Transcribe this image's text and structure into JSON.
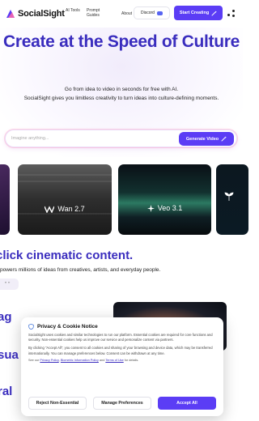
{
  "nav": {
    "brand": "SocialSight",
    "links": {
      "ai_tools": "AI Tools",
      "prompt_guides": "Prompt Guides",
      "about": "About"
    },
    "discord_label": "Discord",
    "start_label": "Start Creating"
  },
  "hero": {
    "title": "Create at the Speed of Culture",
    "subtitle_1": "Go from idea to video in seconds for free with AI.",
    "subtitle_2": "SocialSight gives you limitless creativity to turn ideas into culture-defining moments.",
    "prompt_placeholder": "Imagine anything...",
    "generate_label": "Generate Video"
  },
  "carousel": {
    "cards": [
      {
        "label": "Wan 2.7",
        "icon": "wan-logo-icon"
      },
      {
        "label": "Veo 3.1",
        "icon": "veo-star-icon"
      }
    ]
  },
  "section": {
    "title": "click cinematic content.",
    "subtitle": "powers millions of ideas from creatives, artists, and everyday people.",
    "quote_glyph": "” ”",
    "words": [
      "ag",
      "sua",
      "ral"
    ]
  },
  "cookie": {
    "title": "Privacy & Cookie Notice",
    "para1": "SocialSight uses cookies and similar technologies to run our platform. Essential cookies are required for core functions and security. Non-essential cookies help us improve our service and personalize content via partners.",
    "para2": "By clicking \"Accept All\", you consent to all cookies and sharing of your browsing and device data, which may be transferred internationally. You can manage preferences below. Consent can be withdrawn at any time.",
    "see_prefix": "See our",
    "privacy_link": "Privacy Policy",
    "biometric_link": "Biometric Information Policy",
    "and_text": "and",
    "terms_link": "Terms of Use",
    "see_suffix": "for details.",
    "reject_label": "Reject Non-Essential",
    "manage_label": "Manage Preferences",
    "accept_label": "Accept All"
  },
  "colors": {
    "brand": "#5b3df5",
    "heading": "#3a2dbe"
  }
}
